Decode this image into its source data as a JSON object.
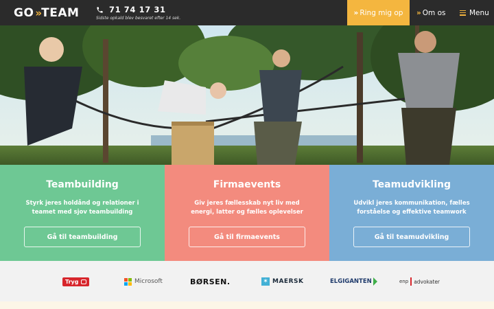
{
  "header": {
    "logo_left": "GO",
    "logo_chevrons": "»",
    "logo_right": "TEAM",
    "phone": "71 74 17 31",
    "phone_note": "Sidste opkald blev besvaret efter 14 sek.",
    "call_label": "Ring mig op",
    "about_label": "Om os",
    "menu_label": "Menu",
    "chevron": "»"
  },
  "colors": {
    "topbar": "#2b2b2b",
    "accent": "#f4b63f",
    "teambuilding": "#6ec894",
    "firmaevents": "#f38b7e",
    "teamudvikling": "#7aaed6"
  },
  "cards": [
    {
      "title": "Teambuilding",
      "text": "Styrk jeres holdånd og relationer i teamet med sjov teambuilding",
      "button": "Gå til teambuilding"
    },
    {
      "title": "Firmaevents",
      "text": "Giv jeres fællesskab nyt liv med energi, latter og fælles oplevelser",
      "button": "Gå til firmaevents"
    },
    {
      "title": "Teamudvikling",
      "text": "Udvikl jeres kommunikation, fælles forståelse og effektive teamwork",
      "button": "Gå til teamudvikling"
    }
  ],
  "partners": {
    "tryg": "Tryg",
    "microsoft": "Microsoft",
    "borsen": "BØRSEN.",
    "maersk": "MAERSK",
    "elgiganten": "ELGIGANTEN",
    "enp_a": "enp",
    "enp_b": "advokater"
  }
}
